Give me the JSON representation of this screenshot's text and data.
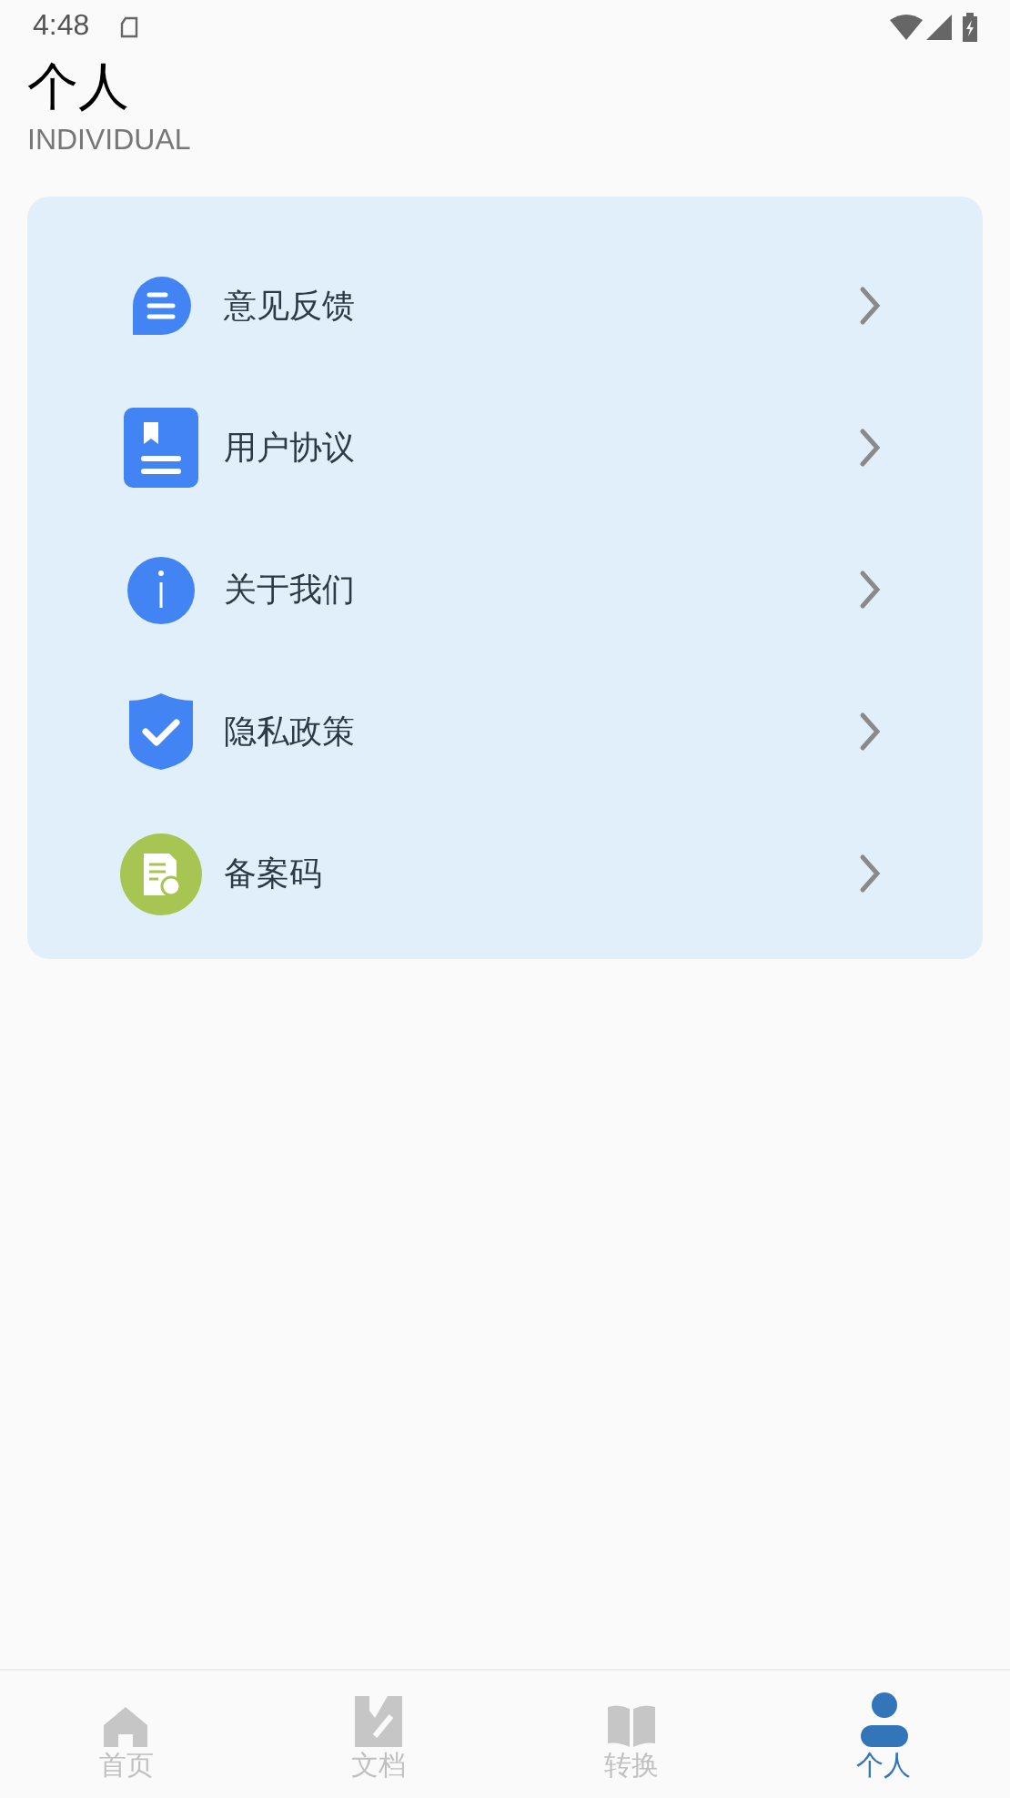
{
  "status_bar": {
    "time": "4:48"
  },
  "header": {
    "title": "个人",
    "subtitle": "INDIVIDUAL"
  },
  "menu": [
    {
      "kind": "feedback",
      "label": "意见反馈"
    },
    {
      "kind": "agreement",
      "label": "用户协议"
    },
    {
      "kind": "about",
      "label": "关于我们"
    },
    {
      "kind": "privacy",
      "label": "隐私政策"
    },
    {
      "kind": "record",
      "label": "备案码"
    }
  ],
  "tab_bar": [
    {
      "kind": "home",
      "label": "首页",
      "selected": false
    },
    {
      "kind": "docs",
      "label": "文档",
      "selected": false
    },
    {
      "kind": "convert",
      "label": "转换",
      "selected": false
    },
    {
      "kind": "profile",
      "label": "个人",
      "selected": true
    }
  ]
}
